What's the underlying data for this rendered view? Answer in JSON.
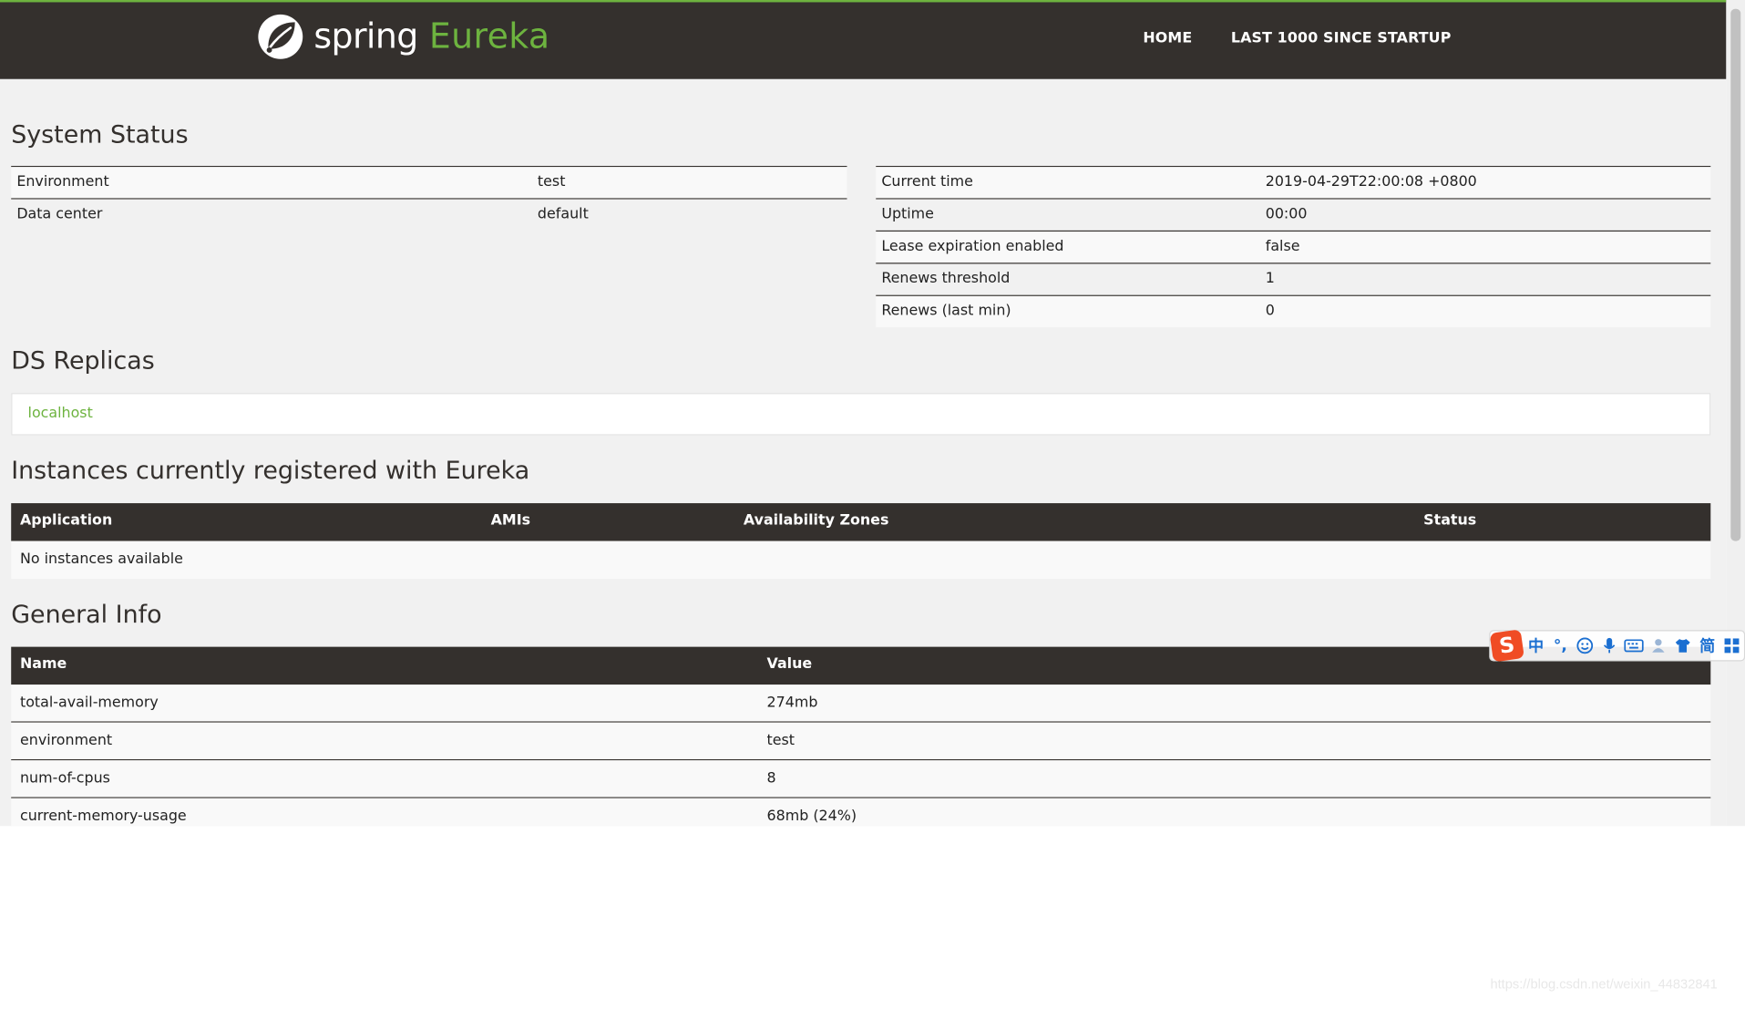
{
  "brand": {
    "spring": "spring",
    "eureka": "Eureka"
  },
  "nav": {
    "home": "HOME",
    "last1000": "LAST 1000 SINCE STARTUP"
  },
  "system_status": {
    "title": "System Status",
    "left": [
      {
        "key": "Environment",
        "value": "test"
      },
      {
        "key": "Data center",
        "value": "default"
      }
    ],
    "right": [
      {
        "key": "Current time",
        "value": "2019-04-29T22:00:08 +0800"
      },
      {
        "key": "Uptime",
        "value": "00:00"
      },
      {
        "key": "Lease expiration enabled",
        "value": "false"
      },
      {
        "key": "Renews threshold",
        "value": "1"
      },
      {
        "key": "Renews (last min)",
        "value": "0"
      }
    ]
  },
  "ds_replicas": {
    "title": "DS Replicas",
    "items": [
      "localhost"
    ]
  },
  "instances": {
    "title": "Instances currently registered with Eureka",
    "columns": [
      "Application",
      "AMIs",
      "Availability Zones",
      "Status"
    ],
    "empty_text": "No instances available"
  },
  "general_info": {
    "title": "General Info",
    "columns": [
      "Name",
      "Value"
    ],
    "rows": [
      {
        "name": "total-avail-memory",
        "value": "274mb"
      },
      {
        "name": "environment",
        "value": "test"
      },
      {
        "name": "num-of-cpus",
        "value": "8"
      },
      {
        "name": "current-memory-usage",
        "value": "68mb (24%)"
      }
    ]
  },
  "ime_toolbar": {
    "logo": "S",
    "items": [
      "中",
      "°,",
      "smiley-icon",
      "microphone-icon",
      "keyboard-icon",
      "user-icon",
      "shirt-icon",
      "简",
      "grid-icon"
    ]
  },
  "watermark": "https://blog.csdn.net/weixin_44832841",
  "colors": {
    "navbar": "#34302d",
    "accent": "#6db33f",
    "background": "#f1f1f1"
  }
}
